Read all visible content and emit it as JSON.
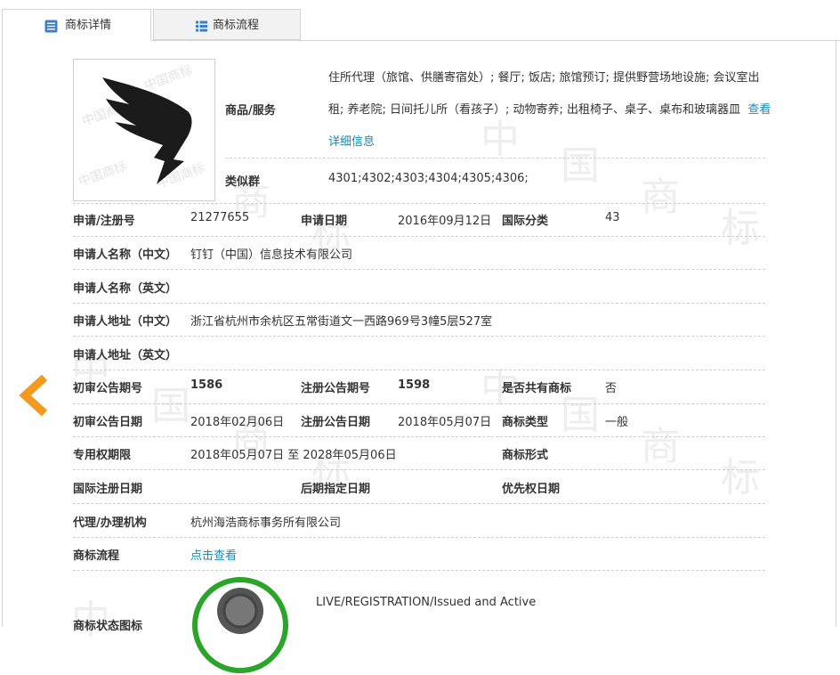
{
  "tabs": [
    {
      "label": "商标详情",
      "icon": "list-lines-icon"
    },
    {
      "label": "商标流程",
      "icon": "list-grid-icon"
    }
  ],
  "watermark": {
    "chars": [
      "中",
      "国",
      "商",
      "标"
    ],
    "stamp_text": "中国商标"
  },
  "goods_services": {
    "label": "商品/服务",
    "text": "住所代理（旅馆、供膳寄宿处）; 餐厅; 饭店; 旅馆预订; 提供野营场地设施; 会议室出租; 养老院; 日间托儿所（看孩子）; 动物寄养; 出租椅子、桌子、桌布和玻璃器皿",
    "more_link": "查看详细信息"
  },
  "similar_group": {
    "label": "类似群",
    "value": "4301;4302;4303;4304;4305;4306;"
  },
  "rows": {
    "reg_no": {
      "label": "申请/注册号",
      "value": "21277655"
    },
    "app_date": {
      "label": "申请日期",
      "value": "2016年09月12日"
    },
    "intl_class": {
      "label": "国际分类",
      "value": "43"
    },
    "applicant_cn": {
      "label": "申请人名称（中文）",
      "value": "钉钉（中国）信息技术有限公司"
    },
    "applicant_en": {
      "label": "申请人名称（英文）",
      "value": ""
    },
    "address_cn": {
      "label": "申请人地址（中文）",
      "value": "浙江省杭州市余杭区五常街道文一西路969号3幢5层527室"
    },
    "address_en": {
      "label": "申请人地址（英文）",
      "value": ""
    },
    "prelim_no": {
      "label": "初审公告期号",
      "value": "1586"
    },
    "reg_pub_no": {
      "label": "注册公告期号",
      "value": "1598"
    },
    "shared": {
      "label": "是否共有商标",
      "value": "否"
    },
    "prelim_date": {
      "label": "初审公告日期",
      "value": "2018年02月06日"
    },
    "reg_pub_date": {
      "label": "注册公告日期",
      "value": "2018年05月07日"
    },
    "tm_type": {
      "label": "商标类型",
      "value": "一般"
    },
    "exclusive": {
      "label": "专用权期限",
      "value": "2018年05月07日 至 2028年05月06日"
    },
    "tm_form": {
      "label": "商标形式",
      "value": ""
    },
    "intl_reg_date": {
      "label": "国际注册日期",
      "value": ""
    },
    "later_date": {
      "label": "后期指定日期",
      "value": ""
    },
    "priority_date": {
      "label": "优先权日期",
      "value": ""
    },
    "agent": {
      "label": "代理/办理机构",
      "value": "杭州海浩商标事务所有限公司"
    },
    "flow": {
      "label": "商标流程",
      "value": "点击查看"
    },
    "status_icon": {
      "label": "商标状态图标",
      "value": "LIVE/REGISTRATION/Issued and Active"
    }
  },
  "colors": {
    "link": "#1a8bb5",
    "accent_orange": "#f39a1e",
    "status_green": "#2aa52a"
  }
}
